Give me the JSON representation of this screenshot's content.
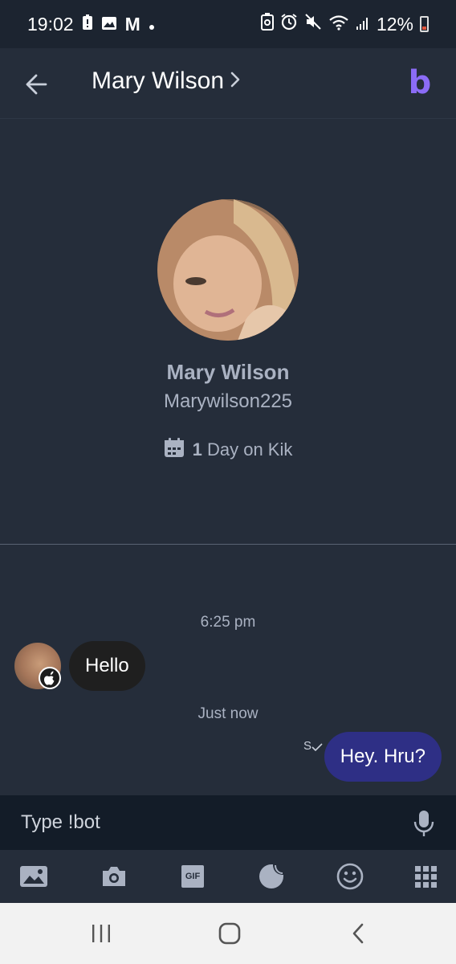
{
  "status_bar": {
    "time": "19:02",
    "carrier_letter": "M",
    "battery_percent": "12%"
  },
  "header": {
    "title": "Mary Wilson",
    "chevron": "›",
    "back_icon": "arrow-left-icon",
    "bot_logo_letter": "b"
  },
  "profile": {
    "name": "Mary Wilson",
    "username": "Marywilson225",
    "days_count": "1",
    "days_text": "Day on Kik"
  },
  "conversation": {
    "messages": [
      {
        "timestamp": "6:25 pm",
        "direction": "incoming",
        "text": "Hello"
      },
      {
        "timestamp": "Just now",
        "direction": "outgoing",
        "text": "Hey. Hru?",
        "receipt": "S"
      }
    ]
  },
  "input": {
    "placeholder": "Type !bot"
  },
  "attachments": {
    "gif_label": "GIF",
    "icons": [
      "gallery-icon",
      "camera-icon",
      "gif-icon",
      "sticker-icon",
      "emoji-icon",
      "apps-grid-icon"
    ]
  },
  "colors": {
    "background": "#252d3a",
    "outgoing_bubble": "#2e2f85",
    "incoming_bubble": "#1f1f1f",
    "muted_text": "#aab2c2",
    "bot_accent": "#8b6cf6"
  }
}
